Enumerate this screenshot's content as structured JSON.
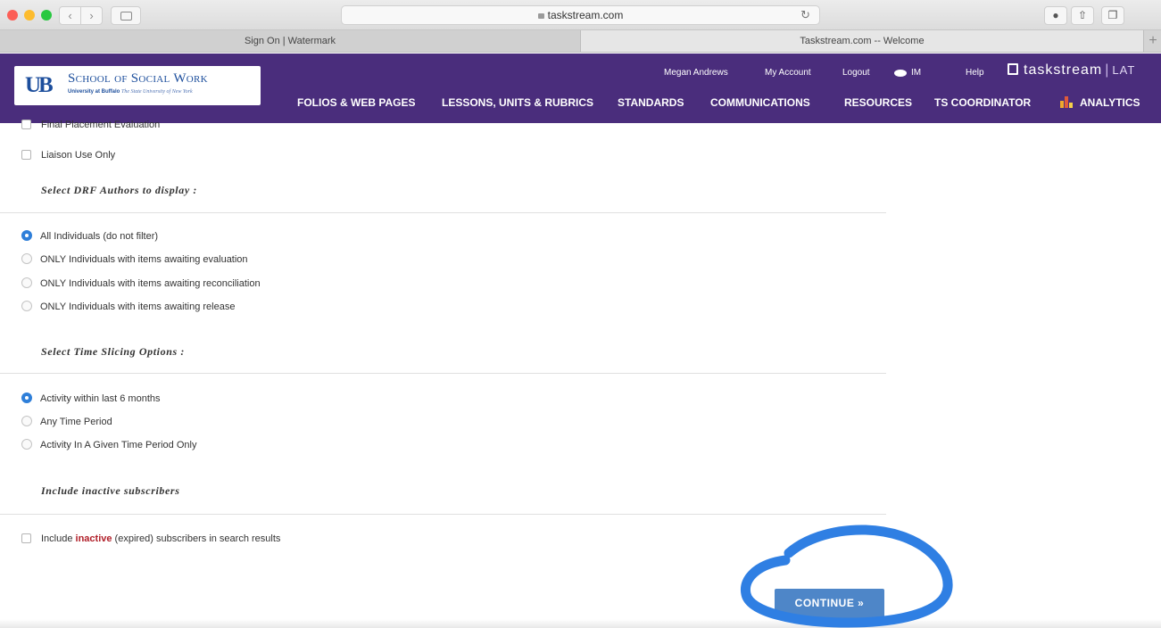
{
  "browser": {
    "address": "taskstream.com",
    "tabs": [
      {
        "label": "Sign On | Watermark"
      },
      {
        "label": "Taskstream.com -- Welcome"
      }
    ],
    "new_tab": "+"
  },
  "header": {
    "logo": {
      "mark": "UB",
      "title": "School of Social Work",
      "sub_bold": "University at Buffalo",
      "sub_italic": "The State University of New York"
    },
    "utility": {
      "user": "Megan Andrews",
      "my_account": "My Account",
      "logout": "Logout",
      "im": "IM",
      "help": "Help"
    },
    "brand": {
      "name": "taskstream",
      "sep": "|",
      "suffix": "LAT"
    },
    "nav": {
      "folios": "FOLIOS & WEB PAGES",
      "lessons": "LESSONS, UNITS & RUBRICS",
      "standards": "STANDARDS",
      "communications": "COMMUNICATIONS",
      "resources": "RESOURCES",
      "ts_coordinator": "TS COORDINATOR",
      "analytics": "ANALYTICS"
    },
    "colors": {
      "header_bg": "#4a2d7c",
      "logo_blue": "#1c4e9c"
    }
  },
  "form": {
    "checkboxes": [
      {
        "label": "Final Placement Evaluation",
        "checked": false
      },
      {
        "label": "Liaison Use Only",
        "checked": false
      }
    ],
    "drf_section": {
      "title": "Select DRF Authors to display :",
      "options": [
        {
          "label": "All Individuals (do not filter)",
          "selected": true
        },
        {
          "label": "ONLY Individuals with items awaiting evaluation",
          "selected": false
        },
        {
          "label": "ONLY Individuals with items awaiting reconciliation",
          "selected": false
        },
        {
          "label": "ONLY Individuals with items awaiting release",
          "selected": false
        }
      ]
    },
    "time_section": {
      "title": "Select Time Slicing Options :",
      "options": [
        {
          "label": "Activity within last 6 months",
          "selected": true
        },
        {
          "label": "Any Time Period",
          "selected": false
        },
        {
          "label": "Activity In A Given Time Period Only",
          "selected": false
        }
      ]
    },
    "inactive_section": {
      "title": "Include inactive subscribers",
      "option": {
        "before": "Include ",
        "highlight": "inactive",
        "after": " (expired) subscribers in search results",
        "checked": false
      }
    },
    "continue_label": "CONTINUE »",
    "colors": {
      "radio_selected": "#2f7fd9",
      "continue_bg": "#4e86c8",
      "highlight_red": "#b1202a",
      "annotation_blue": "#2f7fe3"
    }
  }
}
